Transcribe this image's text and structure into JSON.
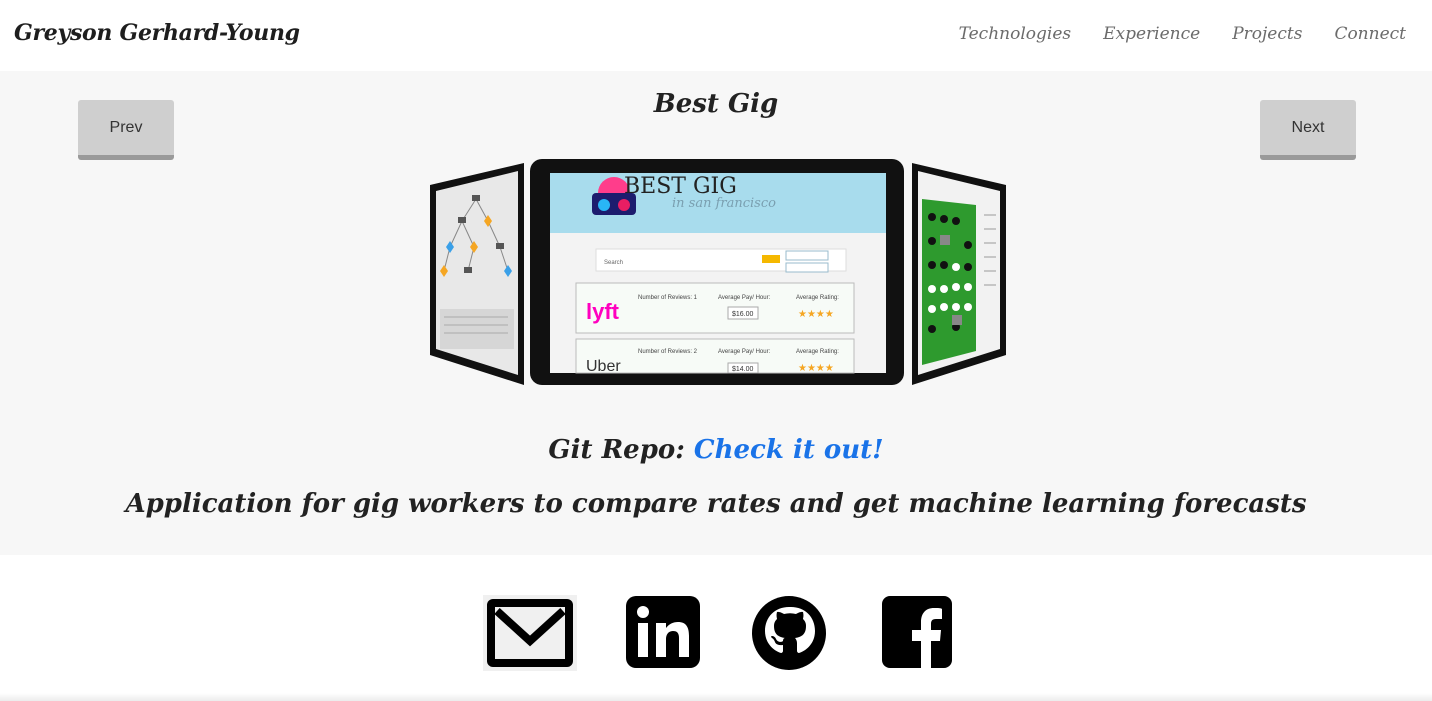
{
  "header": {
    "brand": "Greyson Gerhard-Young",
    "nav": [
      {
        "label": "Technologies"
      },
      {
        "label": "Experience"
      },
      {
        "label": "Projects"
      },
      {
        "label": "Connect"
      }
    ]
  },
  "project": {
    "title": "Best Gig",
    "prev_label": "Prev",
    "next_label": "Next",
    "repo_prefix": "Git Repo:",
    "repo_link": "Check it out!",
    "description": "Application for gig workers to compare rates and get machine learning forecasts",
    "screenshot": {
      "banner_title": "BEST GIG",
      "banner_subtitle": "in san francisco",
      "search_label": "Search",
      "search_button": "Search",
      "rows": [
        {
          "brand": "lyft",
          "reviews_label": "Number of Reviews: 1",
          "pay_label": "Average Pay/ Hour:",
          "pay_value": "$16.00",
          "rating_label": "Average Rating:",
          "stars": "★★★★"
        },
        {
          "brand": "Uber",
          "reviews_label": "Number of Reviews: 2",
          "pay_label": "Average Pay/ Hour:",
          "pay_value": "$14.00",
          "rating_label": "Average Rating:",
          "stars": "★★★★"
        }
      ]
    }
  },
  "footer": {
    "icons": [
      "email-icon",
      "linkedin-icon",
      "github-icon",
      "facebook-icon"
    ],
    "linkedin_text": "in",
    "facebook_text": "f"
  },
  "colors": {
    "link": "#1a73e8",
    "lyft": "#ff00bf",
    "banner": "#a8dced",
    "board_green": "#2e9a2e"
  }
}
